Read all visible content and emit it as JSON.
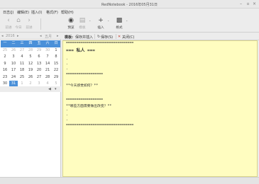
{
  "window": {
    "title": "RedNotebook - 2016年05月31日"
  },
  "menu": [
    "日志(J)",
    "编辑(E)",
    "插入(I)",
    "格式(F)",
    "帮助(H)"
  ],
  "toolbar": {
    "back": "前进",
    "today": "今日",
    "forward": "前进",
    "preview": "预览",
    "template": "模板",
    "insert": "插入",
    "format": "格式"
  },
  "calendar": {
    "year": "2016",
    "month": "五月",
    "weekdays": [
      "一",
      "二",
      "三",
      "四",
      "五",
      "六",
      "日"
    ],
    "rows": [
      [
        "25",
        "26",
        "27",
        "28",
        "29",
        "30",
        "1"
      ],
      [
        "2",
        "3",
        "4",
        "5",
        "6",
        "7",
        "8"
      ],
      [
        "9",
        "10",
        "11",
        "12",
        "13",
        "14",
        "15"
      ],
      [
        "16",
        "17",
        "18",
        "19",
        "20",
        "21",
        "22"
      ],
      [
        "23",
        "24",
        "25",
        "26",
        "27",
        "28",
        "29"
      ],
      [
        "30",
        "31",
        "1",
        "2",
        "3",
        "4",
        "5"
      ]
    ],
    "selected": "31"
  },
  "editor_header": {
    "label": "模板:",
    "save_insert": "保存并插入",
    "save": "保存(S)",
    "close": "关闭(C)"
  },
  "editor_lines": {
    "l1": "=================================",
    "l2": "=== 私人 ===",
    "l3": "-",
    "l4": "-",
    "l5": "-",
    "l6": "==================",
    "l7": "**今天感觉如何？**",
    "l8": "==================",
    "l9": "**哪些方面需要做出改变？**",
    "l10": "-",
    "l11": "-",
    "l12": "-",
    "l13": "================================="
  }
}
